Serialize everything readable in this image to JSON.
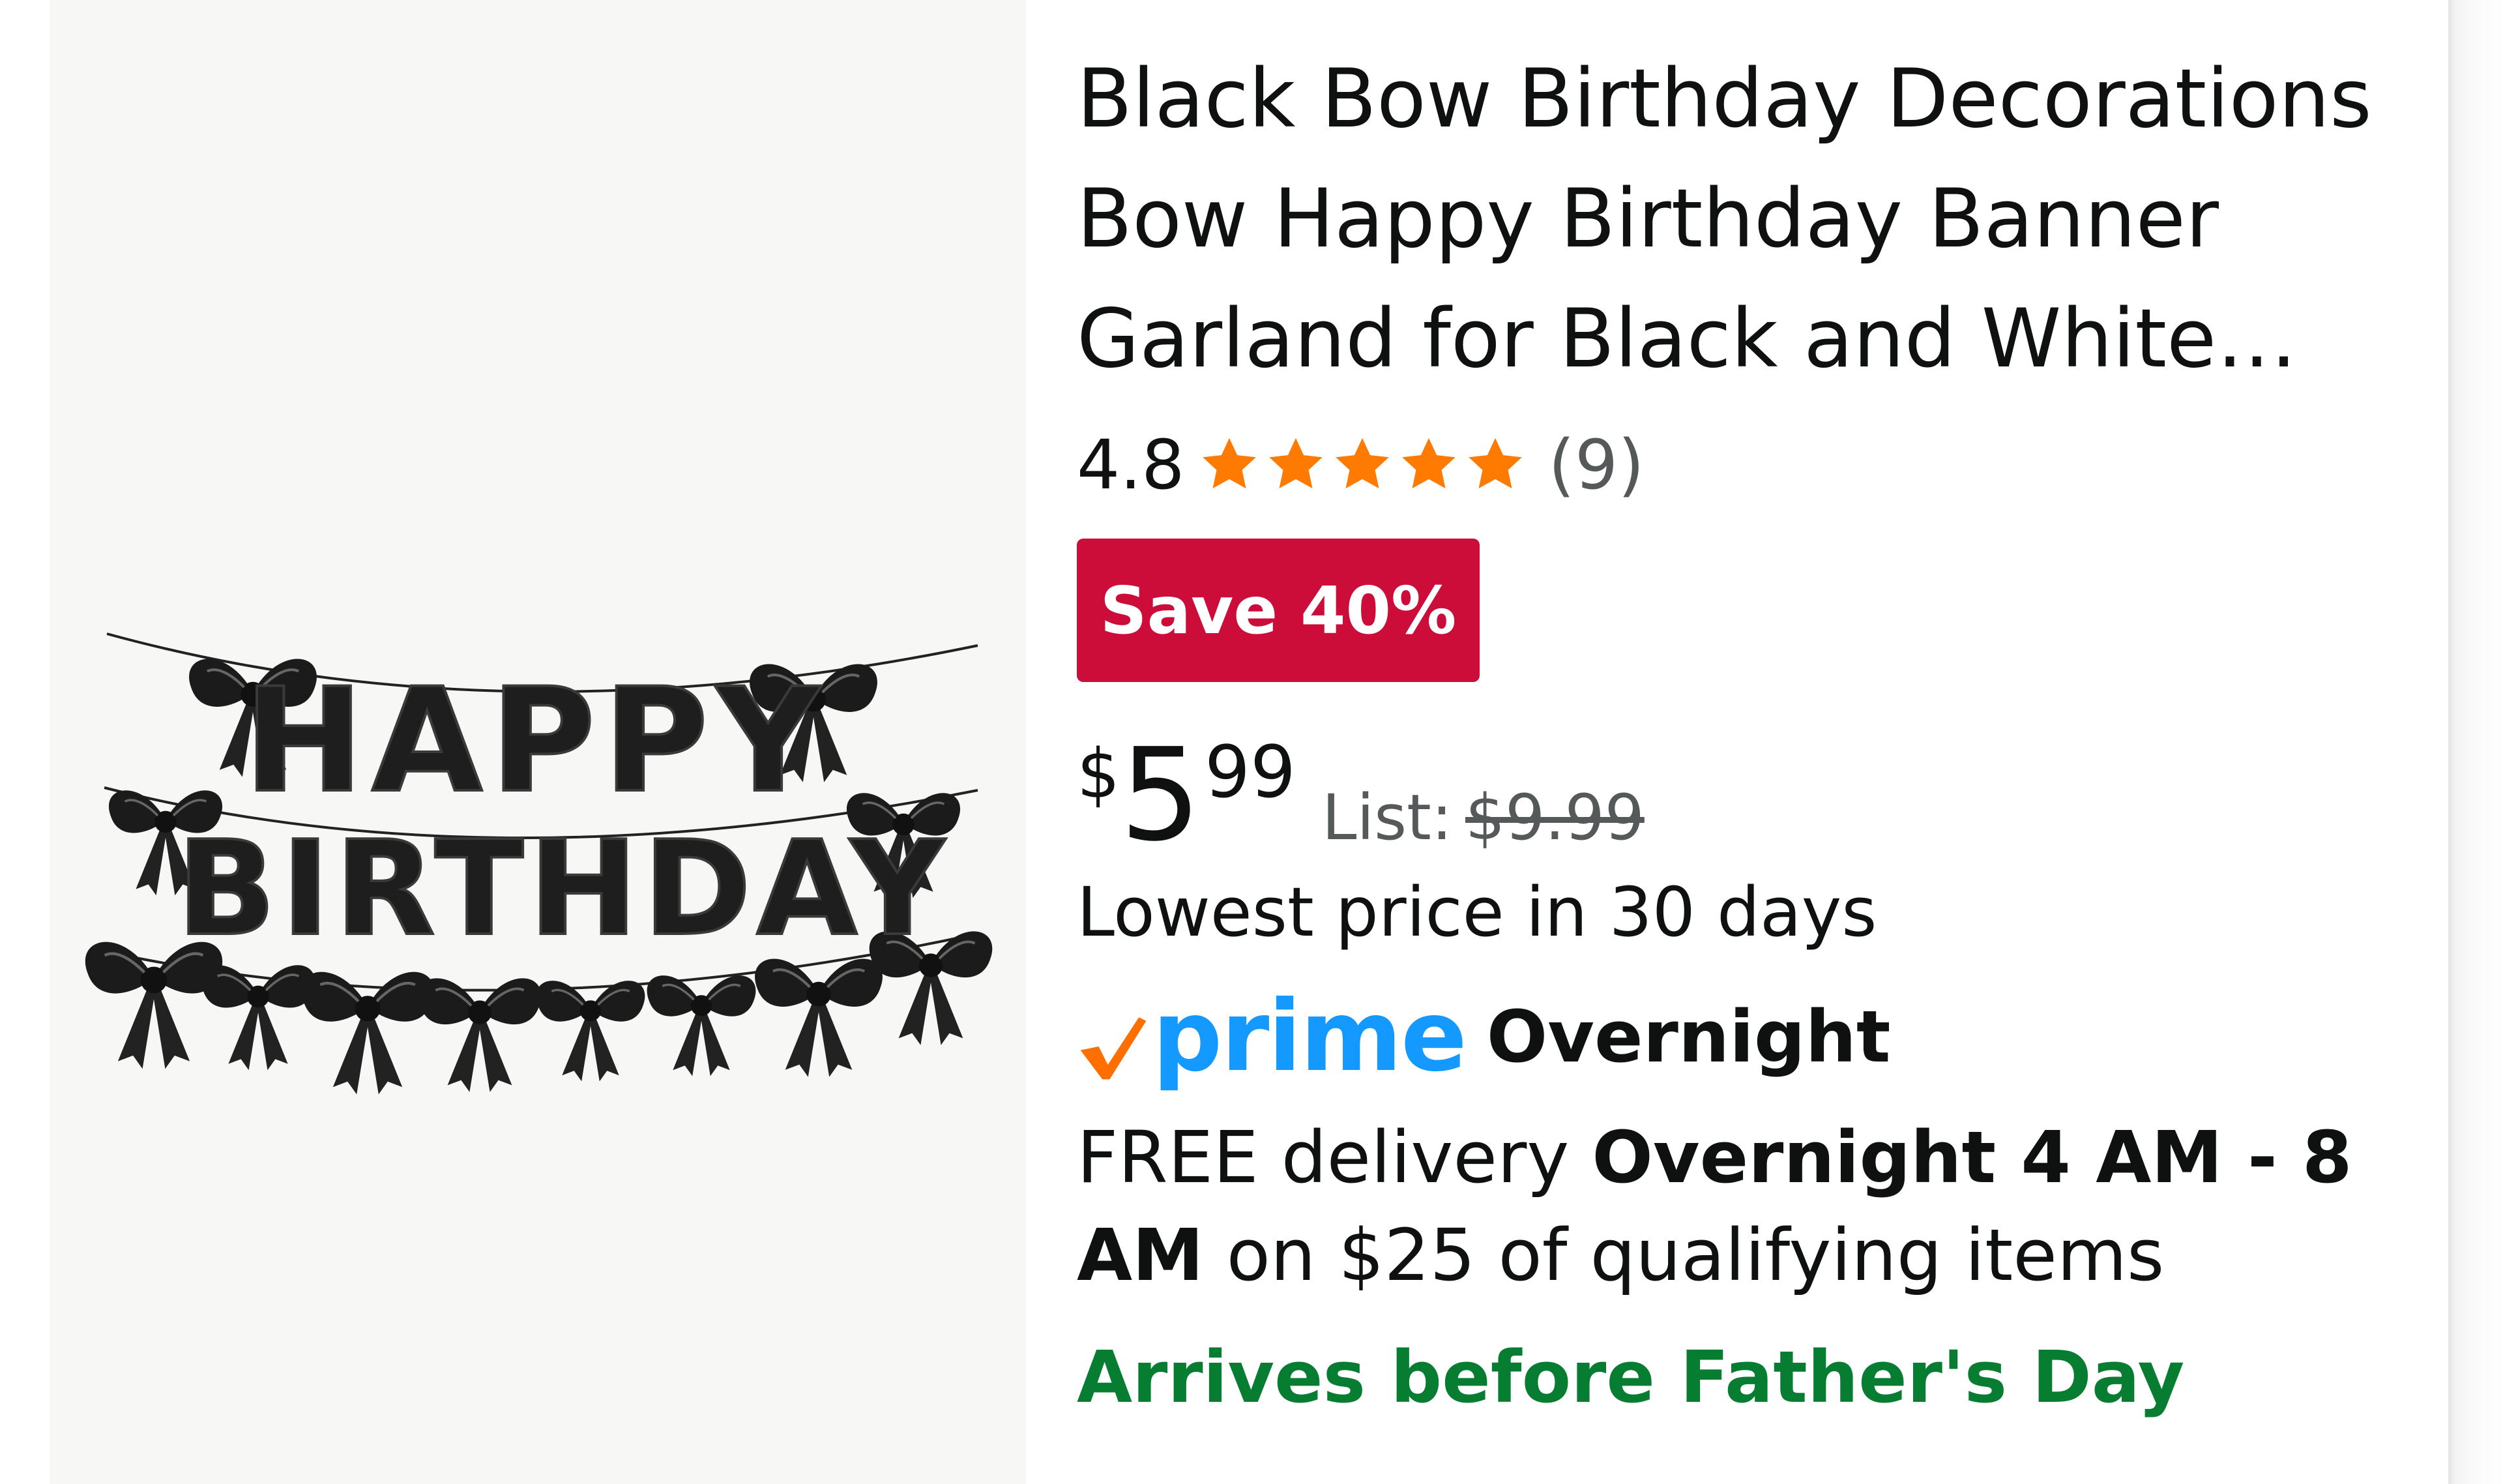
{
  "product": {
    "title": "Black Bow Birthday Decorations Bow Happy Birthday Banner Garland for Black and White Party Decorations",
    "image_text": {
      "line1": "HAPPY",
      "line2": "BIRTHDAY"
    }
  },
  "rating": {
    "value": "4.8",
    "stars": 4.8,
    "count": "(9)",
    "star_color": "#ff7a00"
  },
  "deal": {
    "badge": "Save 40%",
    "badge_color": "#cc0c39"
  },
  "price": {
    "currency": "$",
    "whole": "5",
    "fraction": "99",
    "list_label": "List:",
    "list_price": "$9.99",
    "lowest_note": "Lowest price in 30 days"
  },
  "prime": {
    "logo_text": "prime",
    "logo_color": "#1399ff",
    "check_color": "#ff6f00",
    "speed": "Overnight"
  },
  "delivery": {
    "prefix": "FREE delivery",
    "window": "Overnight 4 AM - 8 AM",
    "suffix": "on $25 of qualifying items",
    "arrives": "Arrives before Father's Day",
    "arrives_color": "#067d31"
  }
}
